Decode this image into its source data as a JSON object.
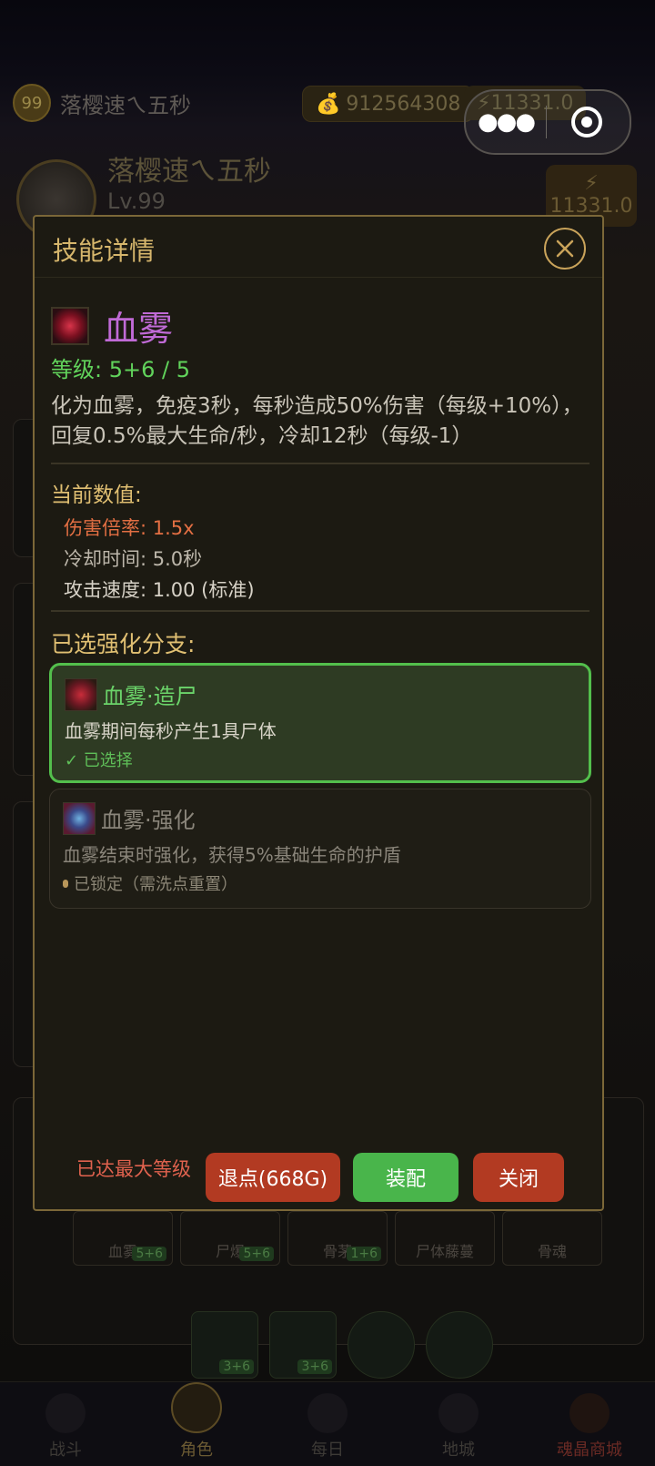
{
  "topbar": {
    "level": "99",
    "name": "落樱速ㄟ五秒",
    "gold": "912564308",
    "energy": "11331.0"
  },
  "profile": {
    "name": "落樱速ㄟ五秒",
    "level": "Lv.99",
    "energy": "11331.0"
  },
  "modal": {
    "title": "技能详情",
    "skill_name": "血雾",
    "level_text": "等级: 5+6 / 5",
    "description": "化为血雾，免疫3秒，每秒造成50%伤害（每级+10%），回复0.5%最大生命/秒，冷却12秒（每级-1）",
    "current_label": "当前数值:",
    "stats": {
      "damage": "伤害倍率: 1.5x",
      "cooldown": "冷却时间: 5.0秒",
      "speed": "攻击速度: 1.00 (标准)"
    },
    "branch_label": "已选强化分支:",
    "branches": [
      {
        "name": "血雾·造尸",
        "desc": "血雾期间每秒产生1具尸体",
        "status": "✓ 已选择"
      },
      {
        "name": "血雾·强化",
        "desc": "血雾结束时强化，获得5%基础生命的护盾",
        "status": "已锁定（需洗点重置）"
      }
    ],
    "max_level": "已达最大等级",
    "buttons": {
      "refund": "退点(668G)",
      "equip": "装配",
      "close": "关闭"
    }
  },
  "background_skills": [
    {
      "name": "血雾",
      "level": "5+6"
    },
    {
      "name": "尸爆",
      "level": "5+6"
    },
    {
      "name": "骨茅",
      "level": "1+6"
    },
    {
      "name": "尸体藤蔓",
      "level": ""
    },
    {
      "name": "骨魂",
      "level": ""
    }
  ],
  "background_skills_row2": [
    {
      "level": "3+6"
    },
    {
      "level": "3+6"
    },
    {
      "level": ""
    },
    {
      "level": ""
    }
  ],
  "nav": [
    {
      "label": "战斗"
    },
    {
      "label": "角色"
    },
    {
      "label": "每日"
    },
    {
      "label": "地城"
    },
    {
      "label": "魂晶商城"
    }
  ],
  "colors": {
    "accent_gold": "#d6b66c",
    "selected_green": "#53bf4c",
    "danger_red": "#b23a22",
    "skill_purple": "#c06ad6"
  }
}
